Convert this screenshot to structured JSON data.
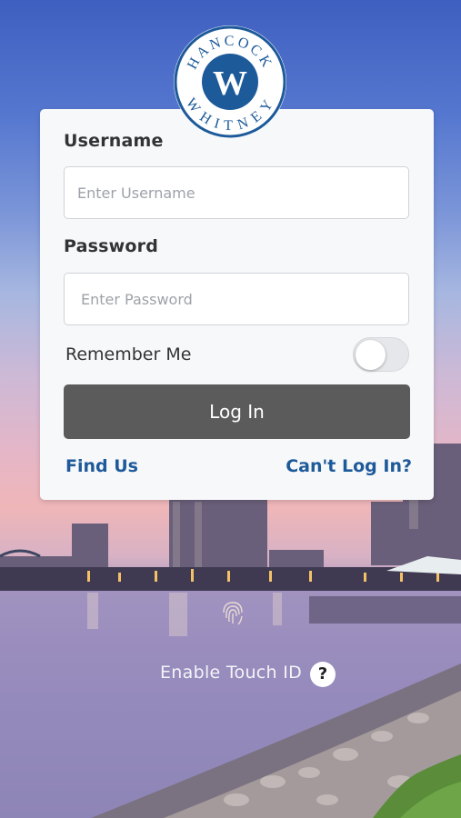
{
  "logo": {
    "top_text": "HANCOCK",
    "bottom_text": "WHITNEY",
    "monogram": "W"
  },
  "login_form": {
    "username_label": "Username",
    "username_placeholder": "Enter Username",
    "password_label": "Password",
    "password_placeholder": "Enter Password",
    "remember_label": "Remember Me",
    "remember_on": false,
    "login_label": "Log In",
    "find_us_label": "Find Us",
    "cant_login_label": "Can't Log In?"
  },
  "touch_id": {
    "label": "Enable Touch ID",
    "help_label": "?"
  },
  "colors": {
    "brand_blue": "#1d5a9a",
    "button_gray": "#5b5b5b",
    "card_bg": "#f7f8fa"
  },
  "icons": [
    "hancock-whitney-logo",
    "fingerprint-icon",
    "help-icon"
  ]
}
